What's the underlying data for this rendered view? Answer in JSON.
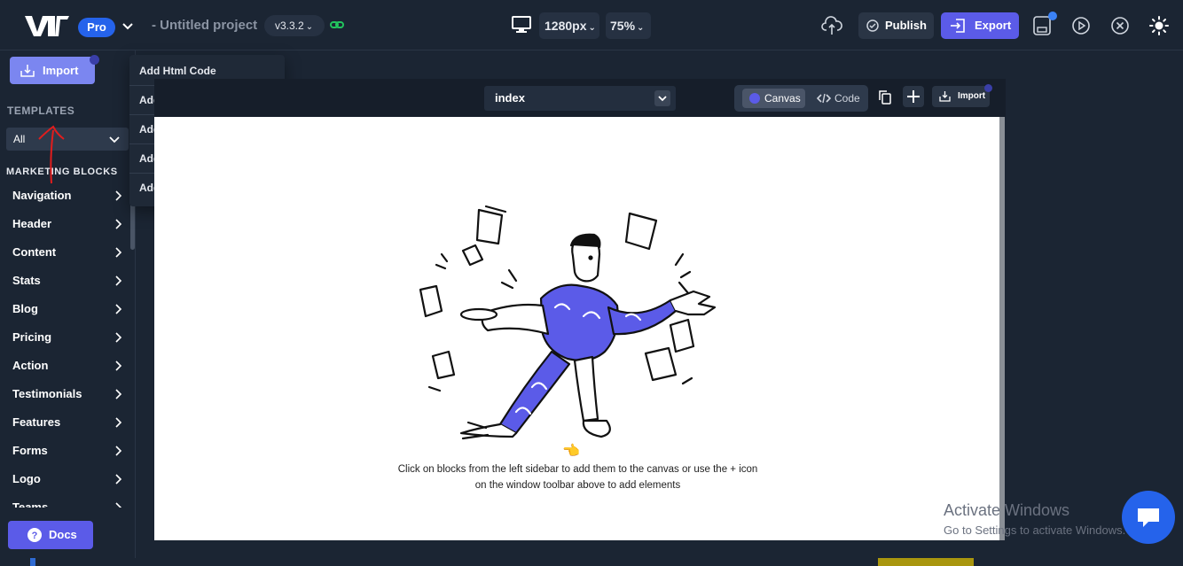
{
  "app": {
    "plan_badge": "Pro",
    "project_name": "- Untitled project",
    "version": "v3.3.2"
  },
  "toolbar": {
    "resolution": "1280px",
    "zoom": "75%",
    "publish_label": "Publish",
    "export_label": "Export"
  },
  "sidebar": {
    "import_label": "Import",
    "templates_label": "TEMPLATES",
    "template_filter": "All",
    "section_label": "MARKETING BLOCKS",
    "items": [
      {
        "label": "Navigation"
      },
      {
        "label": "Header"
      },
      {
        "label": "Content"
      },
      {
        "label": "Stats"
      },
      {
        "label": "Blog"
      },
      {
        "label": "Pricing"
      },
      {
        "label": "Action"
      },
      {
        "label": "Testimonials"
      },
      {
        "label": "Features"
      },
      {
        "label": "Forms"
      },
      {
        "label": "Logo"
      },
      {
        "label": "Teams"
      }
    ],
    "docs_label": "Docs"
  },
  "import_menu": {
    "items": [
      {
        "label": "Add Html Code"
      },
      {
        "label": "Add JS/Scripts"
      },
      {
        "label": "Add Tailwind Config"
      },
      {
        "label": "Add Custom CSS"
      },
      {
        "label": "Add Jsx Code"
      }
    ]
  },
  "window": {
    "page": "index",
    "canvas_tab": "Canvas",
    "code_tab": "Code",
    "import_label": "Import"
  },
  "canvas": {
    "hint": "Click on blocks from the left sidebar to add them to the canvas or use the + icon on the window toolbar above to add elements",
    "pointer_emoji": "👈"
  },
  "watermark": {
    "title": "Activate Windows",
    "subtitle": "Go to Settings to activate Windows."
  },
  "colors": {
    "background": "#1b2533",
    "accent": "#5b5be8",
    "pro_blue": "#2563eb",
    "import_button": "#7b86f0"
  }
}
